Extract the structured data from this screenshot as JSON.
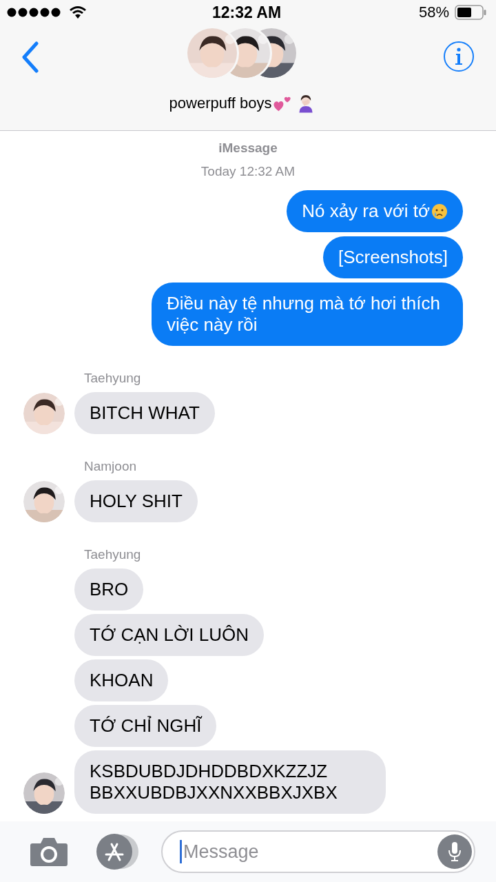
{
  "status_bar": {
    "time": "12:32 AM",
    "battery": "58%"
  },
  "header": {
    "title": "powerpuff boys",
    "title_icons": [
      {
        "kind": "hearts"
      },
      {
        "kind": "facepalm"
      }
    ]
  },
  "service": "iMessage",
  "timestamp": "Today 12:32 AM",
  "groups": [
    {
      "kind": "outgoing",
      "messages": [
        {
          "text": "Nó xảy ra với tớ",
          "emoji": {
            "kind": "crying"
          }
        },
        {
          "text": "[Screenshots]"
        },
        {
          "text": "Điều này tệ nhưng mà tớ hơi thích việc này rồi"
        }
      ]
    },
    {
      "kind": "incoming",
      "sender": "Taehyung",
      "messages": [
        {
          "text": "BITCH WHAT"
        }
      ]
    },
    {
      "kind": "incoming",
      "sender": "Namjoon",
      "messages": [
        {
          "text": "HOLY SHIT"
        }
      ]
    },
    {
      "kind": "incoming",
      "sender": "Taehyung",
      "messages": [
        {
          "text": "BRO"
        },
        {
          "text": "TỚ CẠN LỜI LUÔN"
        },
        {
          "text": "KHOAN"
        },
        {
          "text": "TỚ CHỈ NGHĨ"
        },
        {
          "text": "KSBDUBDJDHDDBDXKZZJZ BBXXUBDBJXXNXXBBXJXBX"
        }
      ]
    }
  ],
  "composer": {
    "placeholder": "Message"
  }
}
